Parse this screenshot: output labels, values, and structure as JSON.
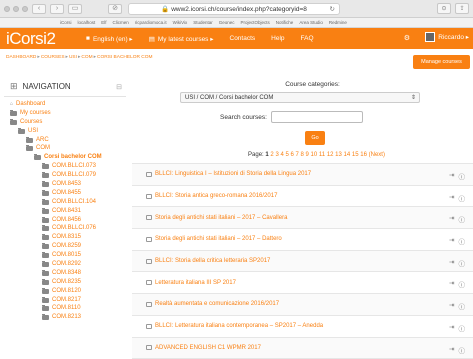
{
  "browser": {
    "url": "www2.icorsi.ch/course/index.php?categoryid=8",
    "bookmarks": [
      "iCorsi",
      "localhost",
      "Elf",
      "Clicmen",
      "ricpardiomoca.it",
      "WikiVix",
      "Studentar",
      "Geonec",
      "ProjectObjects",
      "Notifiche",
      "Area Studio",
      "Redmine"
    ]
  },
  "topnav": {
    "logo": "iCorsi2",
    "language": "English (en) ▸",
    "my_courses": "My latest courses ▸",
    "contacts": "Contacts",
    "help": "Help",
    "faq": "FAQ",
    "user": "Riccardo ▸"
  },
  "breadcrumb": [
    "DASHBOARD",
    "COURSES",
    "USI",
    "COM",
    "CORSI BACHELOR COM"
  ],
  "manage_button": "Manage courses",
  "navigation": {
    "title": "NAVIGATION",
    "items": [
      {
        "label": "Dashboard",
        "level": 0,
        "icon": "home"
      },
      {
        "label": "My courses",
        "level": 0,
        "icon": "folder"
      },
      {
        "label": "Courses",
        "level": 0,
        "icon": "folder"
      },
      {
        "label": "USI",
        "level": 1,
        "icon": "folder"
      },
      {
        "label": "ARC",
        "level": 2,
        "icon": "folder"
      },
      {
        "label": "COM",
        "level": 2,
        "icon": "folder"
      },
      {
        "label": "Corsi bachelor COM",
        "level": 3,
        "icon": "folder",
        "bold": true
      },
      {
        "label": "COM.BLLCI.073",
        "level": 4,
        "icon": "folder"
      },
      {
        "label": "COM.BLLCI.079",
        "level": 4,
        "icon": "folder"
      },
      {
        "label": "COM.8453",
        "level": 4,
        "icon": "folder"
      },
      {
        "label": "COM.8455",
        "level": 4,
        "icon": "folder"
      },
      {
        "label": "COM.BLLCI.104",
        "level": 4,
        "icon": "folder"
      },
      {
        "label": "COM.8431",
        "level": 4,
        "icon": "folder"
      },
      {
        "label": "COM.8456",
        "level": 4,
        "icon": "folder"
      },
      {
        "label": "COM.BLLCI.076",
        "level": 4,
        "icon": "folder"
      },
      {
        "label": "COM.8315",
        "level": 4,
        "icon": "folder"
      },
      {
        "label": "COM.8259",
        "level": 4,
        "icon": "folder"
      },
      {
        "label": "COM.8015",
        "level": 4,
        "icon": "folder"
      },
      {
        "label": "COM.8292",
        "level": 4,
        "icon": "folder"
      },
      {
        "label": "COM.8348",
        "level": 4,
        "icon": "folder"
      },
      {
        "label": "COM.8235",
        "level": 4,
        "icon": "folder"
      },
      {
        "label": "COM.8120",
        "level": 4,
        "icon": "folder"
      },
      {
        "label": "COM.8217",
        "level": 4,
        "icon": "folder"
      },
      {
        "label": "COM.8110",
        "level": 4,
        "icon": "folder"
      },
      {
        "label": "COM.8213",
        "level": 4,
        "icon": "folder"
      }
    ]
  },
  "main": {
    "categories_label": "Course categories:",
    "selected_category": "USI / COM / Corsi bachelor COM",
    "search_label": "Search courses:",
    "search_value": "",
    "go_label": "Go",
    "page_label": "Page:",
    "current_page": "1",
    "pages": [
      "2",
      "3",
      "4",
      "5",
      "6",
      "7",
      "8",
      "9",
      "10",
      "11",
      "12",
      "13",
      "14",
      "15",
      "16"
    ],
    "next_label": "(Next)",
    "courses": [
      "BLLCI: Linguistica I – Istituzioni di Storia della Lingua 2017",
      "BLLCI: Storia antica greco-romana 2016/2017",
      "Storia degli antichi stati italiani – 2017 – Cavallera",
      "Storia degli antichi stati italiani – 2017 – Dattero",
      "BLLCI: Storia della critica letteraria SP2017",
      "Letteratura italiana III SP 2017",
      "Realtà aumentata e comunicazione 2016/2017",
      "BLLCI: Letteratura italiana contemporanea – SP2017 – Anedda",
      "ADVANCED ENGLISH C1 WPMR 2017"
    ]
  }
}
